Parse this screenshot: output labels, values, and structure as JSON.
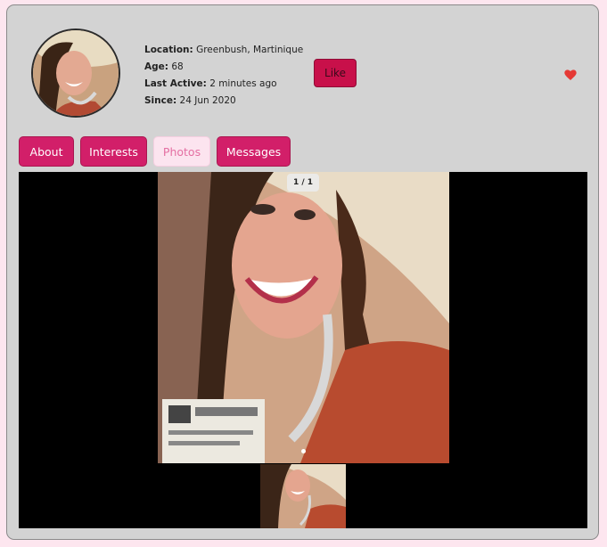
{
  "profile": {
    "location_label": "Location:",
    "location": "Greenbush, Martinique",
    "age_label": "Age:",
    "age": "68",
    "last_active_label": "Last Active:",
    "last_active": "2 minutes ago",
    "since_label": "Since:",
    "since": "24 Jun 2020"
  },
  "actions": {
    "like_label": "Like",
    "favorite_icon": "heart-icon"
  },
  "tabs": [
    {
      "label": "About"
    },
    {
      "label": "Interests"
    },
    {
      "label": "Photos",
      "active": true
    },
    {
      "label": "Messages"
    }
  ],
  "gallery": {
    "counter": "1 / 1"
  },
  "colors": {
    "accent": "#d21f69",
    "like": "#c8104a",
    "heart": "#e53935",
    "card": "#d3d3d3"
  }
}
